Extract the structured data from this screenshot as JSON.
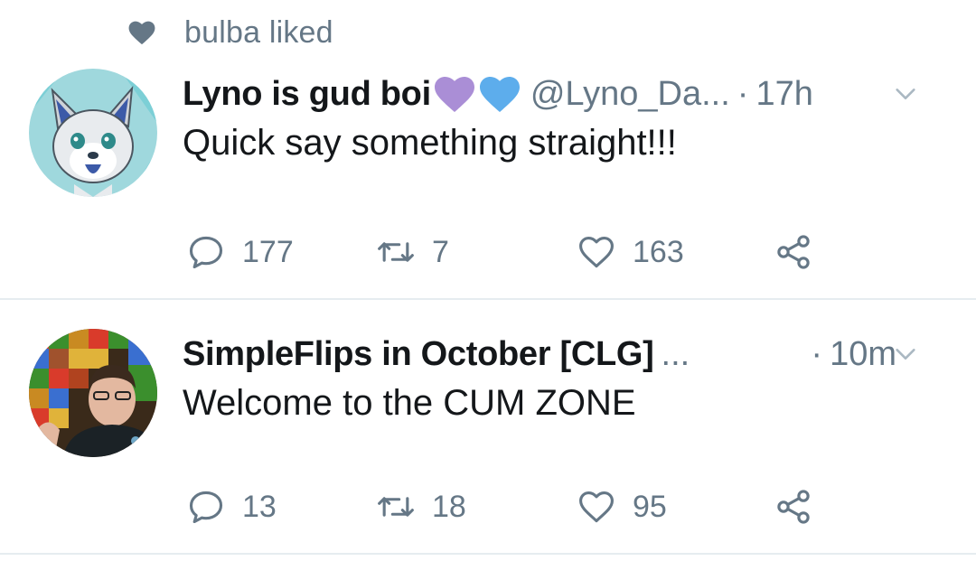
{
  "social_context": {
    "text": "bulba liked",
    "icon": "heart-icon"
  },
  "tweets": [
    {
      "name": "Lyno is gud boi",
      "emoji": [
        "purple-heart-emoji",
        "blue-heart-emoji"
      ],
      "handle": "@Lyno_Da...",
      "dot": "·",
      "time": "17h",
      "text": "Quick say something straight!!!",
      "replies": "177",
      "retweets": "7",
      "likes": "163"
    },
    {
      "name": "SimpleFlips in October [CLG]",
      "ellipsis": "...",
      "dot": "·",
      "time": "10m",
      "text": "Welcome to the CUM ZONE",
      "replies": "13",
      "retweets": "18",
      "likes": "95"
    }
  ],
  "colors": {
    "text_primary": "#14171a",
    "text_secondary": "#657786",
    "divider": "#e6ecf0",
    "purple_heart": "#aa8ed6",
    "blue_heart": "#5dadec"
  }
}
